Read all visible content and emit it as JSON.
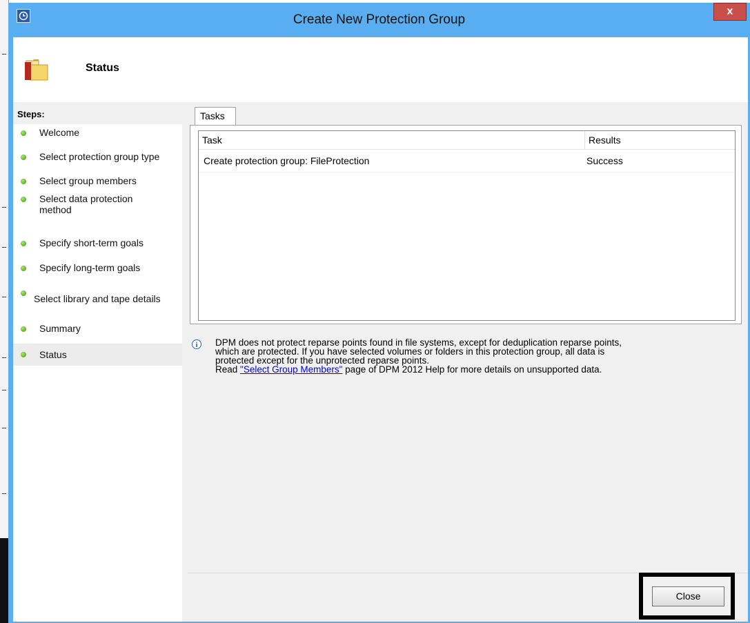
{
  "window": {
    "title": "Create New Protection Group",
    "close_glyph": "x",
    "app_icon": "dpm-clock-icon"
  },
  "header": {
    "icon": "folder-icon",
    "title": "Status"
  },
  "steps": {
    "heading": "Steps:",
    "items": [
      {
        "label": "Welcome"
      },
      {
        "label": "Select protection group type"
      },
      {
        "label": "Select group members"
      },
      {
        "label": "Select data protection method"
      },
      {
        "label": "Specify short-term goals"
      },
      {
        "label": "Specify long-term goals"
      },
      {
        "label": "Select library and tape details"
      },
      {
        "label": "Summary"
      },
      {
        "label": "Status"
      }
    ],
    "active_index": 8,
    "status_color": "#3d9a14"
  },
  "tabs": {
    "tasks_label": "Tasks"
  },
  "table": {
    "columns": [
      "Task",
      "Results"
    ],
    "rows": [
      {
        "task": "Create protection group: FileProtection",
        "result": "Success"
      }
    ]
  },
  "info": {
    "line1": "DPM does not protect reparse points found in file systems, except for deduplication reparse points,",
    "line2": "which are protected. If you have selected volumes or folders in this protection group, all data is",
    "line3": "protected except for the  unprotected reparse points.",
    "read_prefix": "Read ",
    "link_text": "\"Select Group Members\"",
    "read_suffix": " page of DPM 2012 Help for more details on unsupported data."
  },
  "footer": {
    "close_label": "Close"
  },
  "colors": {
    "titlebar": "#58aef0",
    "close_button": "#c7504a",
    "link": "#0000ee"
  }
}
